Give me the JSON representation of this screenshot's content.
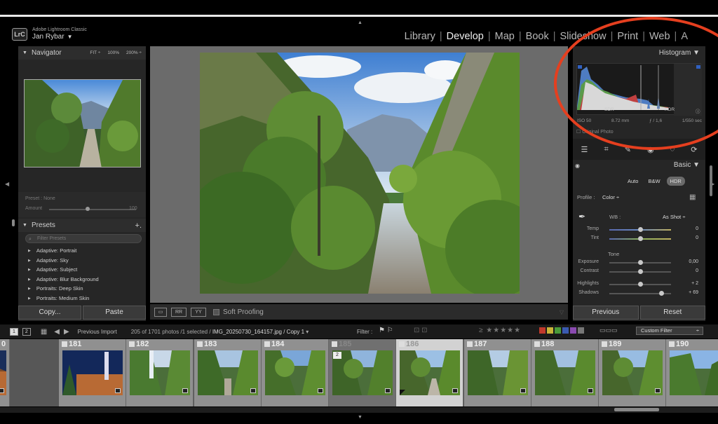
{
  "app": {
    "product": "Adobe Lightroom Classic",
    "user": "Jan Rybar",
    "logo": "LrC"
  },
  "modules": [
    {
      "label": "Library",
      "active": false
    },
    {
      "label": "Develop",
      "active": true
    },
    {
      "label": "Map",
      "active": false
    },
    {
      "label": "Book",
      "active": false
    },
    {
      "label": "Slideshow",
      "active": false
    },
    {
      "label": "Print",
      "active": false
    },
    {
      "label": "Web",
      "active": false
    },
    {
      "label": "A",
      "active": false
    }
  ],
  "navigator": {
    "title": "Navigator",
    "zoom_fit": "FIT ÷",
    "zoom_100": "100%",
    "zoom_200": "200% ÷"
  },
  "preset_panel": {
    "preset_line": "Preset : None",
    "amount_label": "Amount",
    "amount_value": "100",
    "amount_level": 0.44
  },
  "presets": {
    "title": "Presets",
    "plus": "+.",
    "filter_placeholder": "Filter Presets",
    "items": [
      "Adaptive: Portrait",
      "Adaptive: Sky",
      "Adaptive: Subject",
      "Adaptive: Blur Background",
      "Portraits: Deep Skin",
      "Portraits: Medium Skin"
    ]
  },
  "left_buttons": {
    "copy": "Copy...",
    "paste": "Paste"
  },
  "toolbar": {
    "soft_proofing": "Soft Proofing"
  },
  "histogram": {
    "title": "Histogram",
    "sdr": "SDR",
    "hdr": "HDR",
    "exif": {
      "iso": "ISO 50",
      "focal": "8.72 mm",
      "aperture": "ƒ / 1,6",
      "shutter": "1/550 sec"
    },
    "original_photo": "Original Photo"
  },
  "basic": {
    "title": "Basic",
    "treatment": [
      "Auto",
      "B&W",
      "HDR"
    ],
    "profile_label": "Profile :",
    "profile_value": "Color ÷",
    "wb_label": "WB :",
    "wb_value": "As Shot ÷",
    "tone_label": "Tone",
    "sliders": [
      {
        "label": "Temp",
        "value": "0",
        "level": 0.5,
        "color": "#6a8ac0"
      },
      {
        "label": "Tint",
        "value": "0",
        "level": 0.5,
        "color": "#8ab05a"
      },
      {
        "label": "Exposure",
        "value": "0,00",
        "level": 0.5,
        "color": "#555555"
      },
      {
        "label": "Contrast",
        "value": "0",
        "level": 0.5,
        "color": "#555555"
      },
      {
        "label": "Highlights",
        "value": "+ 2",
        "level": 0.51,
        "color": "#555555"
      },
      {
        "label": "Shadows",
        "value": "+ 69",
        "level": 0.85,
        "color": "#555555"
      }
    ]
  },
  "right_buttons": {
    "previous": "Previous",
    "reset": "Reset"
  },
  "filmstrip_bar": {
    "view1": "1",
    "view2": "2",
    "previous_import": "Previous Import",
    "info_prefix": "205 of 1701 photos /1 selected /",
    "info_file": "IMG_20250730_164157.jpg / Copy 1",
    "filter_label": "Filter :",
    "custom_filter": "Custom Filter"
  },
  "filmstrip": [
    {
      "number": "0",
      "style": "normal"
    },
    {
      "number": "181",
      "style": "normal"
    },
    {
      "number": "182",
      "style": "normal"
    },
    {
      "number": "183",
      "style": "normal"
    },
    {
      "number": "184",
      "style": "normal"
    },
    {
      "number": "185",
      "style": "dim",
      "stack": "2"
    },
    {
      "number": "186",
      "style": "selected"
    },
    {
      "number": "187",
      "style": "normal"
    },
    {
      "number": "188",
      "style": "normal"
    },
    {
      "number": "189",
      "style": "normal"
    },
    {
      "number": "190",
      "style": "normal"
    }
  ],
  "label_colors": [
    "#c0392b",
    "#c9b43a",
    "#4a9a3a",
    "#3a5ab0",
    "#8a4ab0",
    "#777777"
  ],
  "annotation_color": "#e53f1f"
}
